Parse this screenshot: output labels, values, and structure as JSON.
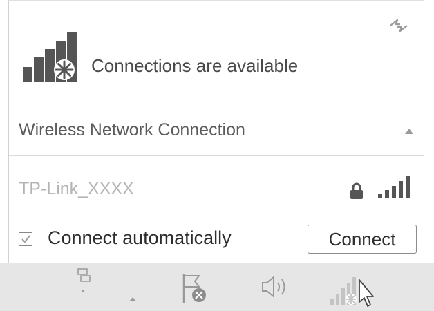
{
  "flyout": {
    "status_text": "Connections are available",
    "section_title": "Wireless Network Connection",
    "network": {
      "ssid": "TP-Link_XXXX",
      "secured": true,
      "signal_bars": 4
    },
    "connect_automatically_label": "Connect automatically",
    "connect_automatically_checked": true,
    "connect_button_label": "Connect"
  },
  "icons": {
    "refresh": "refresh-icon",
    "status": "signal-available-icon",
    "collapse": "chevron-up-icon",
    "lock": "lock-icon",
    "signal": "signal-strength-icon",
    "taskbar": [
      "network-adapter-icon",
      "show-hidden-icons-chevron",
      "action-center-flag-icon",
      "volume-icon",
      "wireless-network-icon",
      "mouse-cursor-icon"
    ]
  },
  "colors": {
    "taskbar_bg": "#e6e6e6",
    "ssid_text": "#b4b4b4",
    "status_icon": "#555555"
  }
}
